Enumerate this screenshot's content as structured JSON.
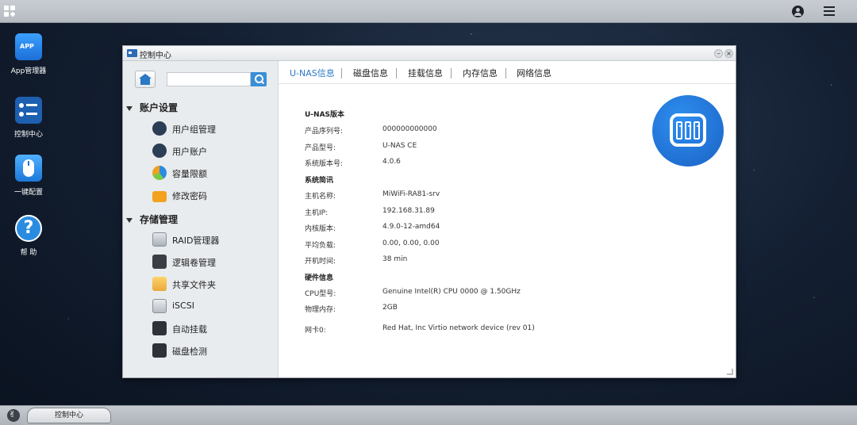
{
  "topbar": {
    "apps_icon": "grid-icon",
    "user_icon": "user-icon",
    "menu_icon": "list-icon"
  },
  "desktop": {
    "icons": [
      {
        "label": "App管理器",
        "icon": "app-store-icon",
        "badge": "APP"
      },
      {
        "label": "控制中心",
        "icon": "control-center-icon"
      },
      {
        "label": "一键配置",
        "icon": "mouse-icon"
      },
      {
        "label": "帮 助",
        "icon": "help-icon",
        "glyph": "?"
      }
    ]
  },
  "window": {
    "title": "控制中心",
    "min_glyph": "–",
    "close_glyph": "×",
    "search": {
      "placeholder": "",
      "value": ""
    },
    "sidebar": {
      "groups": [
        {
          "label": "账户设置",
          "items": [
            {
              "label": "用户组管理",
              "icon": "user-group-icon"
            },
            {
              "label": "用户账户",
              "icon": "user-account-icon"
            },
            {
              "label": "容量限额",
              "icon": "quota-icon"
            },
            {
              "label": "修改密码",
              "icon": "lock-icon"
            }
          ]
        },
        {
          "label": "存储管理",
          "items": [
            {
              "label": "RAID管理器",
              "icon": "raid-icon"
            },
            {
              "label": "逻辑卷管理",
              "icon": "volume-icon"
            },
            {
              "label": "共享文件夹",
              "icon": "shared-folder-icon"
            },
            {
              "label": "iSCSI",
              "icon": "iscsi-icon"
            },
            {
              "label": "自动挂载",
              "icon": "auto-mount-icon"
            },
            {
              "label": "磁盘检测",
              "icon": "disk-check-icon"
            }
          ]
        }
      ]
    },
    "tabs": [
      "U-NAS信息",
      "磁盘信息",
      "挂载信息",
      "内存信息",
      "网络信息"
    ],
    "active_tab": 0,
    "info": {
      "section_version": "U-NAS版本",
      "serial_label": "产品序列号:",
      "serial_value": "000000000000",
      "model_label": "产品型号:",
      "model_value": "U-NAS CE",
      "sysver_label": "系统版本号:",
      "sysver_value": "4.0.6",
      "section_system": "系统简讯",
      "hostname_label": "主机名称:",
      "hostname_value": "MiWiFi-RA81-srv",
      "ip_label": "主机IP:",
      "ip_value": "192.168.31.89",
      "kernel_label": "内核版本:",
      "kernel_value": "4.9.0-12-amd64",
      "load_label": "平均负载:",
      "load_value": "0.00, 0.00, 0.00",
      "uptime_label": "开机时间:",
      "uptime_value": "38 min",
      "section_hardware": "硬件信息",
      "cpu_label": "CPU型号:",
      "cpu_value": "Genuine Intel(R) CPU 0000 @ 1.50GHz",
      "mem_label": "物理内存:",
      "mem_value": "2GB",
      "nic_label": "网卡0:",
      "nic_value": "Red Hat, Inc Virtio network device (rev 01)"
    },
    "logo_icon": "u-nas-logo-icon"
  },
  "taskbar": {
    "start_icon": "start-icon",
    "tasks": [
      "控制中心"
    ]
  },
  "colors": {
    "accent": "#2b78c5",
    "logo_blue": "#1a75d6"
  }
}
